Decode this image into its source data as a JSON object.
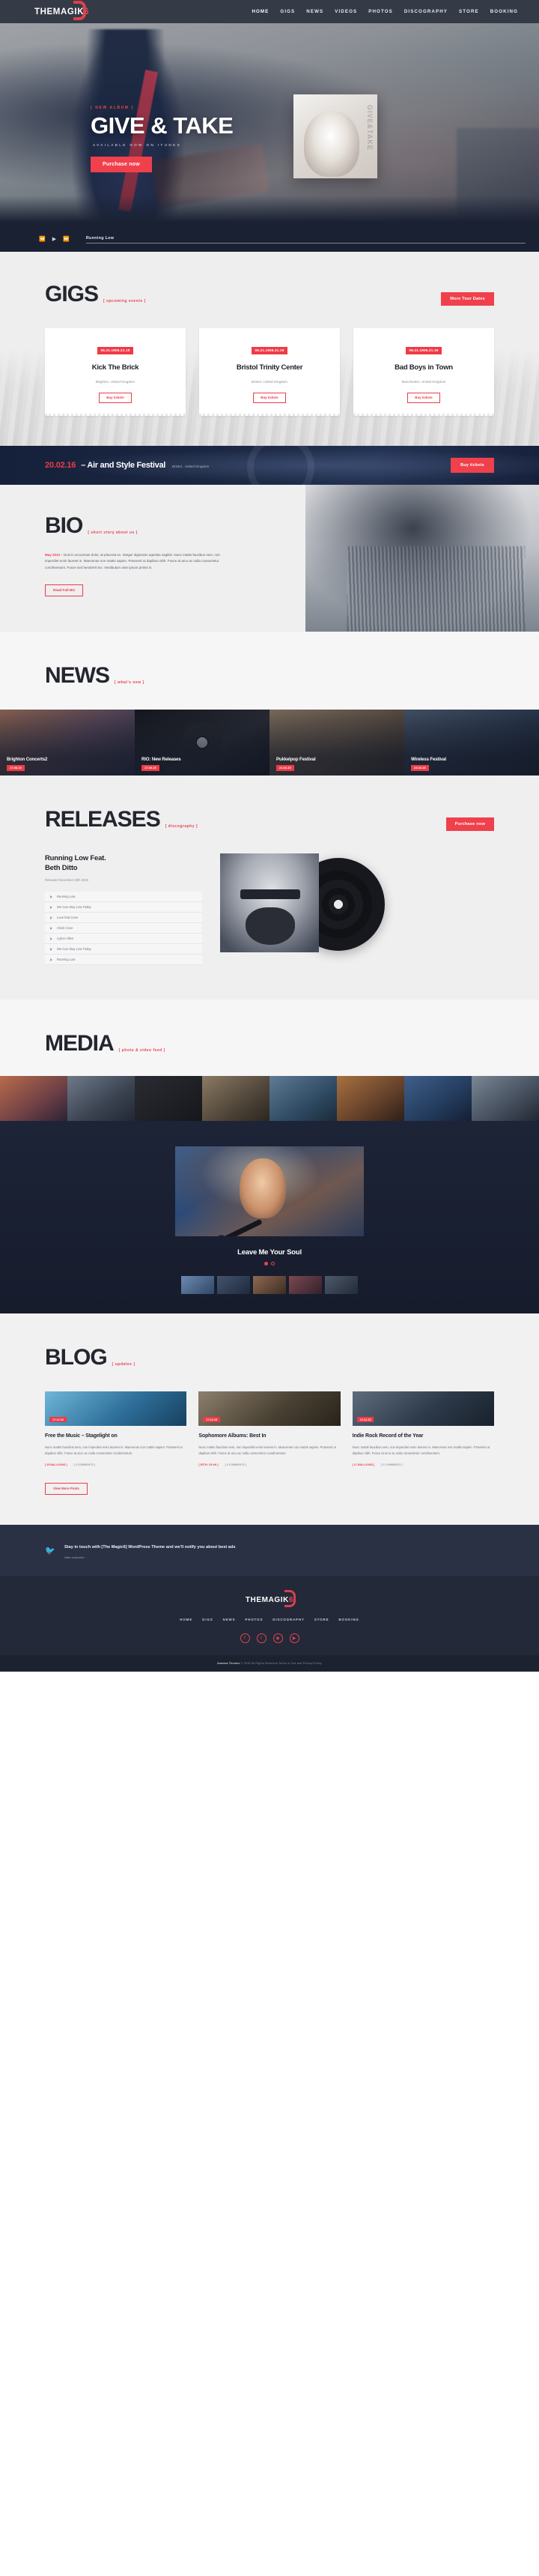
{
  "brand": {
    "name_white": "THEMAGIK",
    "name_red": "6"
  },
  "nav": {
    "items": [
      "HOME",
      "GIGS",
      "NEWS",
      "VIDEOS",
      "PHOTOS",
      "DISCOGRAPHY",
      "STORE",
      "BOOKING"
    ]
  },
  "colors": {
    "accent": "#ef3b46",
    "dark": "#343a46",
    "hero_dark": "#1a2133",
    "footer": "#232938"
  },
  "hero": {
    "kicker": "[ new album ]",
    "title": "GIVE & TAKE",
    "subtitle": "AVAILABLE NOW ON ITUNES",
    "cta": "Purchase now",
    "album_side_label": "GIVE&TAKE"
  },
  "player": {
    "prev_icon": "skip-back-icon",
    "play_icon": "play-icon",
    "next_icon": "skip-forward-icon",
    "track": "Running Low"
  },
  "gigs": {
    "title": "GIGS",
    "tag": "[ upcoming events ]",
    "more_label": "More Tour Dates",
    "cards": [
      {
        "date": "06.21.1906.21.19",
        "name": "Kick The Brick",
        "place": "Brighton, United Kingdom",
        "button": "Buy tickets"
      },
      {
        "date": "06.21.1906.21.19",
        "name": "Bristol Trinity Center",
        "place": "Bristol, United Kingdom",
        "button": "Buy tickets"
      },
      {
        "date": "06.21.1906.21.19",
        "name": "Bad Boys in Town",
        "place": "Manchester, United Kingdom",
        "button": "Buy tickets"
      }
    ]
  },
  "festival": {
    "date": "20.02.16",
    "name": "– Air and Style Festival",
    "location": "Bristol , United Kingdom",
    "cta": "Buy tickets"
  },
  "bio": {
    "title": "BIO",
    "tag": "[ short story about us ]",
    "date_highlight": "May 2013",
    "body": "– Duis in accumsan dolor, at placerat ex. Integer dignissim egestas sagittis. Nunc mattis faucibus sem, non imperdiet enim laoreet in. Maecenas non mattis sapien. Praesent ut dapibus nibh. Fusce at arcu ac nulla consectetur condimentum. Fusce sed hendrerit leo. Vestibulum ante ipsum primis in.",
    "cta": "Read Full Bio"
  },
  "news": {
    "title": "NEWS",
    "tag": "[ what's new ]",
    "cards": [
      {
        "title": "Brighton Concerts2",
        "date": "17.08.15"
      },
      {
        "title": "RIO: New Releases",
        "date": "17.08.15"
      },
      {
        "title": "Pukkelpop Festival",
        "date": "21.04.15"
      },
      {
        "title": "Wireless Festival",
        "date": "23.04.15"
      }
    ]
  },
  "releases": {
    "title": "RELEASES",
    "tag": "[ discography ]",
    "purchase_label": "Purchase now",
    "album_title": "Running Low Feat.\nBeth Ditto",
    "album_meta": "Released November 30th 2015",
    "tracks": [
      "Running Low",
      "We Can Stay Low Today",
      "Love that Cave",
      "Clock Cove",
      "Cyber Allies",
      "We Can Stay Low Today",
      "Running Low"
    ]
  },
  "media": {
    "title": "MEDIA",
    "tag": "[ photo & video feed ]"
  },
  "video": {
    "title": "Leave Me Your Soul",
    "dots": 2
  },
  "blog": {
    "title": "BLOG",
    "tag": "[ updates ]",
    "more_label": "View More Posts",
    "posts": [
      {
        "date": "17.12.15",
        "title": "Free the Music – Stagelight on",
        "excerpt": "Nunc mattis faucibus sem, non imperdiet enim laoreet in. Maecenas non mattis sapien. Praesent ut dapibus nibh. Fusce at arcu ac nulla consectetur condimentum.",
        "meta_likes": "[ 25 BALLOONS ]",
        "meta_comments": "[ 0 COMMENTS ]"
      },
      {
        "date": "17.12.15",
        "title": "Sophomore Albums: Best In",
        "excerpt": "Nunc mattis faucibus sem, non imperdiet enim laoreet in. Maecenas non mattis sapien. Praesent ut dapibus nibh. Fusce at arcu ac nulla consectetur condimentum.",
        "meta_likes": "[ 50TH / 29 AN ]",
        "meta_comments": "[ 0 COMMENTS ]"
      },
      {
        "date": "10.12.15",
        "title": "Indie Rock Record of the Year",
        "excerpt": "Nunc mattis faucibus sem, non imperdiet enim laoreet in. Maecenas non mattis sapien. Praesent ut dapibus nibh. Fusce at arcu ac nulla consectetur condimentum.",
        "meta_likes": "[ 27 BALLOONS ]",
        "meta_comments": "[ 0 COMMENTS ]"
      }
    ]
  },
  "subscribe": {
    "icon": "twitter-icon",
    "line1": "Stay in touch with [The Magic6] WordPress Theme and we'll notify you about best ads",
    "line2": "After subscribe"
  },
  "footer": {
    "nav": [
      "HOME",
      "GIGS",
      "NEWS",
      "PHOTOS",
      "DISCOGRAPHY",
      "STORE",
      "BOOKING"
    ],
    "social": [
      "facebook-icon",
      "twitter-icon",
      "instagram-icon",
      "youtube-icon"
    ],
    "copyright_brand": "Asmara Themes",
    "copyright_rest": "© 2015 All Rights Reserved Terms of Use and Privacy Policy"
  }
}
